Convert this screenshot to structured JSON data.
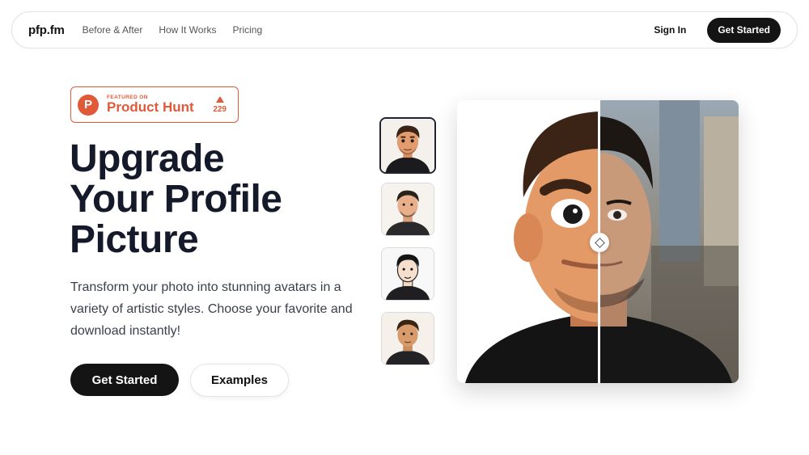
{
  "nav": {
    "logo": "pfp.fm",
    "links": [
      "Before & After",
      "How It Works",
      "Pricing"
    ],
    "sign_in": "Sign In",
    "cta": "Get Started"
  },
  "badge": {
    "small": "FEATURED ON",
    "big": "Product Hunt",
    "logo_letter": "P",
    "votes": "229"
  },
  "hero": {
    "headline_lines": [
      "Upgrade",
      "Your Profile",
      "Picture"
    ],
    "subtext": "Transform your photo into stunning avatars in a variety of artistic styles. Choose your favorite and download instantly!",
    "primary_button": "Get Started",
    "secondary_button": "Examples"
  },
  "thumbnails": {
    "styles": [
      "3d-cartoon",
      "flat-illustration",
      "line-art",
      "illustrated"
    ],
    "selected_index": 0
  },
  "comparison": {
    "split_fraction": 0.5
  },
  "colors": {
    "primary": "#141414",
    "accent_product_hunt": "#e05a3a",
    "heading": "#151a2a"
  }
}
